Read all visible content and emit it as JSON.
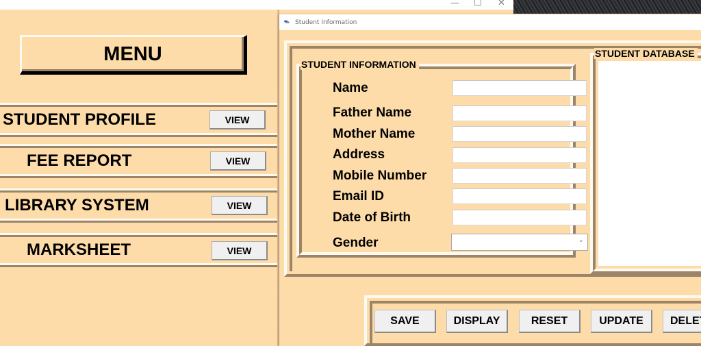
{
  "background_window": {
    "controls": {
      "minimize": "—",
      "maximize": "☐",
      "close": "✕"
    }
  },
  "menu": {
    "title": "MENU",
    "items": [
      {
        "label": "STUDENT PROFILE",
        "button": "VIEW"
      },
      {
        "label": "FEE REPORT",
        "button": "VIEW"
      },
      {
        "label": "LIBRARY SYSTEM",
        "button": "VIEW"
      },
      {
        "label": "MARKSHEET",
        "button": "VIEW"
      }
    ]
  },
  "student_window": {
    "title": "Student Information",
    "icon": "feather-icon",
    "info_group": {
      "legend": "STUDENT INFORMATION",
      "fields": [
        {
          "label": "Name",
          "value": ""
        },
        {
          "label": "Father Name",
          "value": ""
        },
        {
          "label": "Mother Name",
          "value": ""
        },
        {
          "label": "Address",
          "value": ""
        },
        {
          "label": "Mobile Number",
          "value": ""
        },
        {
          "label": "Email ID",
          "value": ""
        },
        {
          "label": "Date of Birth",
          "value": ""
        }
      ],
      "gender": {
        "label": "Gender",
        "selected": ""
      }
    },
    "database_group": {
      "legend": "STUDENT DATABASE"
    },
    "actions": [
      "SAVE",
      "DISPLAY",
      "RESET",
      "UPDATE",
      "DELETE"
    ]
  }
}
